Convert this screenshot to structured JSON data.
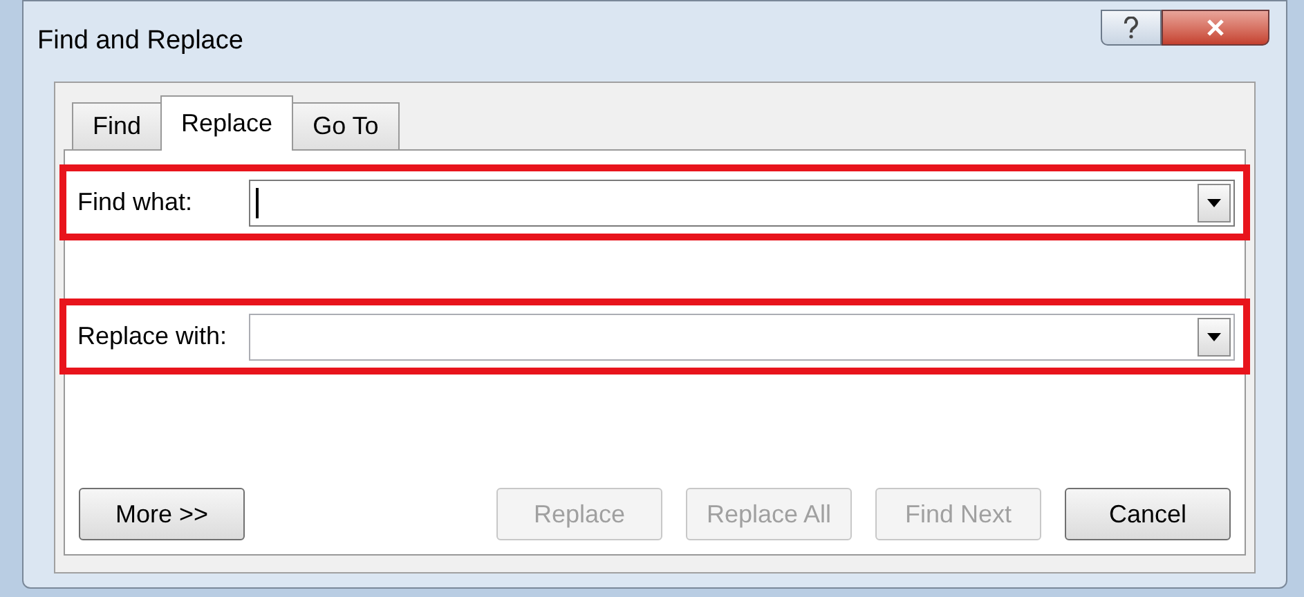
{
  "window": {
    "title": "Find and Replace"
  },
  "tabs": [
    {
      "label": "Find",
      "selected": false
    },
    {
      "label": "Replace",
      "selected": true
    },
    {
      "label": "Go To",
      "selected": false
    }
  ],
  "fields": [
    {
      "label": "Find what:",
      "focused": true,
      "highlighted": true
    },
    {
      "label": "Replace with:",
      "focused": false,
      "highlighted": true
    }
  ],
  "buttons": [
    {
      "label": "More >>",
      "disabled": false
    },
    {
      "label": "Replace",
      "disabled": true
    },
    {
      "label": "Replace All",
      "disabled": true
    },
    {
      "label": "Find Next",
      "disabled": true
    },
    {
      "label": "Cancel",
      "disabled": false
    }
  ]
}
